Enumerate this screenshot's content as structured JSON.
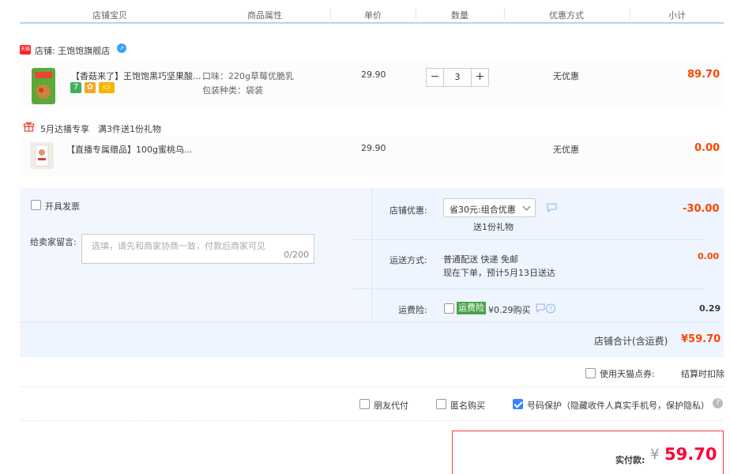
{
  "header": {
    "col_item": "店铺宝贝",
    "col_props": "商品属性",
    "col_price": "单价",
    "col_qty": "数量",
    "col_discount": "优惠方式",
    "col_subtotal": "小计"
  },
  "shop": {
    "badge": "天猫",
    "name": "店铺: 王饱饱旗舰店"
  },
  "items": [
    {
      "title": "【香菇来了】王饱饱黑巧坚果酸...",
      "prop1": "口味：220g草莓优脆乳",
      "prop2": "包装种类：袋装",
      "price": "29.90",
      "qty": "3",
      "discount": "无优惠",
      "subtotal": "89.70",
      "tag1": "7"
    },
    {
      "title": "【直播专属赠品】100g蜜桃乌...",
      "price": "29.90",
      "discount": "无优惠",
      "subtotal": "0.00"
    }
  ],
  "promo": {
    "label": "5月达播专享",
    "detail": "满3件送1份礼物"
  },
  "order": {
    "invoice_label": "开具发票",
    "message_label": "给卖家留言:",
    "message_placeholder": "选填，请先和商家协商一致，付款后商家可见",
    "message_count": "0/200",
    "shop_discount_label": "店铺优惠:",
    "shop_discount_select": "省30元:组合优惠",
    "shop_discount_note": "送1份礼物",
    "shop_discount_value": "-30.00",
    "shipping_label": "运送方式:",
    "shipping_line1": "普通配送 快递 免邮",
    "shipping_line2": "现在下单，预计5月13日送达",
    "shipping_value": "0.00",
    "insurance_label": "运费险:",
    "insurance_tag": "运费险",
    "insurance_price": "¥0.29购买",
    "insurance_value": "0.29",
    "shop_total_label": "店铺合计(含运费)",
    "shop_total_value": "¥59.70"
  },
  "options": {
    "coupon_label": "使用天猫点券:",
    "coupon_note": "结算时扣除",
    "friend_pay": "朋友代付",
    "anonymous": "匿名购买",
    "privacy": "号码保护（隐藏收件人真实手机号，保护隐私）"
  },
  "payment": {
    "label": "实付款:",
    "currency": "¥",
    "amount": "59.70"
  },
  "colors": {
    "accent_blue": "#3385ff",
    "price_orange": "#ff4400",
    "pay_red": "#ff0036"
  }
}
